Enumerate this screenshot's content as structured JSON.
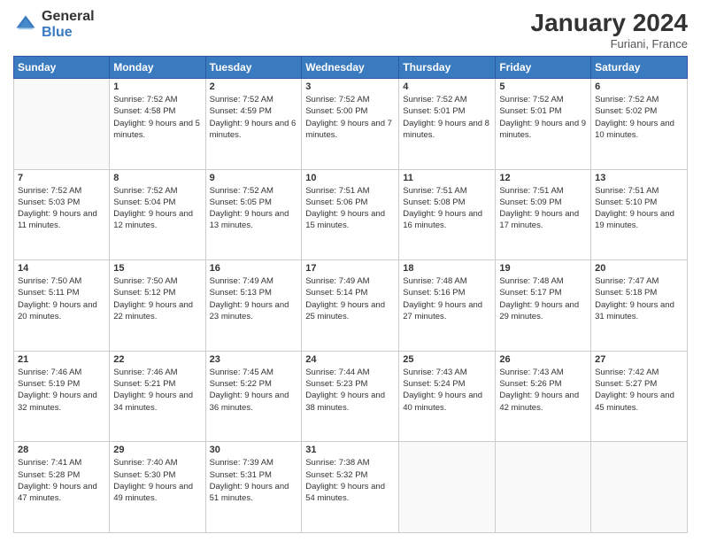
{
  "header": {
    "logo_general": "General",
    "logo_blue": "Blue",
    "month_title": "January 2024",
    "location": "Furiani, France"
  },
  "weekdays": [
    "Sunday",
    "Monday",
    "Tuesday",
    "Wednesday",
    "Thursday",
    "Friday",
    "Saturday"
  ],
  "weeks": [
    [
      {
        "day": "",
        "empty": true
      },
      {
        "day": "1",
        "sunrise": "7:52 AM",
        "sunset": "4:58 PM",
        "daylight": "9 hours and 5 minutes."
      },
      {
        "day": "2",
        "sunrise": "7:52 AM",
        "sunset": "4:59 PM",
        "daylight": "9 hours and 6 minutes."
      },
      {
        "day": "3",
        "sunrise": "7:52 AM",
        "sunset": "5:00 PM",
        "daylight": "9 hours and 7 minutes."
      },
      {
        "day": "4",
        "sunrise": "7:52 AM",
        "sunset": "5:01 PM",
        "daylight": "9 hours and 8 minutes."
      },
      {
        "day": "5",
        "sunrise": "7:52 AM",
        "sunset": "5:01 PM",
        "daylight": "9 hours and 9 minutes."
      },
      {
        "day": "6",
        "sunrise": "7:52 AM",
        "sunset": "5:02 PM",
        "daylight": "9 hours and 10 minutes."
      }
    ],
    [
      {
        "day": "7",
        "sunrise": "7:52 AM",
        "sunset": "5:03 PM",
        "daylight": "9 hours and 11 minutes."
      },
      {
        "day": "8",
        "sunrise": "7:52 AM",
        "sunset": "5:04 PM",
        "daylight": "9 hours and 12 minutes."
      },
      {
        "day": "9",
        "sunrise": "7:52 AM",
        "sunset": "5:05 PM",
        "daylight": "9 hours and 13 minutes."
      },
      {
        "day": "10",
        "sunrise": "7:51 AM",
        "sunset": "5:06 PM",
        "daylight": "9 hours and 15 minutes."
      },
      {
        "day": "11",
        "sunrise": "7:51 AM",
        "sunset": "5:08 PM",
        "daylight": "9 hours and 16 minutes."
      },
      {
        "day": "12",
        "sunrise": "7:51 AM",
        "sunset": "5:09 PM",
        "daylight": "9 hours and 17 minutes."
      },
      {
        "day": "13",
        "sunrise": "7:51 AM",
        "sunset": "5:10 PM",
        "daylight": "9 hours and 19 minutes."
      }
    ],
    [
      {
        "day": "14",
        "sunrise": "7:50 AM",
        "sunset": "5:11 PM",
        "daylight": "9 hours and 20 minutes."
      },
      {
        "day": "15",
        "sunrise": "7:50 AM",
        "sunset": "5:12 PM",
        "daylight": "9 hours and 22 minutes."
      },
      {
        "day": "16",
        "sunrise": "7:49 AM",
        "sunset": "5:13 PM",
        "daylight": "9 hours and 23 minutes."
      },
      {
        "day": "17",
        "sunrise": "7:49 AM",
        "sunset": "5:14 PM",
        "daylight": "9 hours and 25 minutes."
      },
      {
        "day": "18",
        "sunrise": "7:48 AM",
        "sunset": "5:16 PM",
        "daylight": "9 hours and 27 minutes."
      },
      {
        "day": "19",
        "sunrise": "7:48 AM",
        "sunset": "5:17 PM",
        "daylight": "9 hours and 29 minutes."
      },
      {
        "day": "20",
        "sunrise": "7:47 AM",
        "sunset": "5:18 PM",
        "daylight": "9 hours and 31 minutes."
      }
    ],
    [
      {
        "day": "21",
        "sunrise": "7:46 AM",
        "sunset": "5:19 PM",
        "daylight": "9 hours and 32 minutes."
      },
      {
        "day": "22",
        "sunrise": "7:46 AM",
        "sunset": "5:21 PM",
        "daylight": "9 hours and 34 minutes."
      },
      {
        "day": "23",
        "sunrise": "7:45 AM",
        "sunset": "5:22 PM",
        "daylight": "9 hours and 36 minutes."
      },
      {
        "day": "24",
        "sunrise": "7:44 AM",
        "sunset": "5:23 PM",
        "daylight": "9 hours and 38 minutes."
      },
      {
        "day": "25",
        "sunrise": "7:43 AM",
        "sunset": "5:24 PM",
        "daylight": "9 hours and 40 minutes."
      },
      {
        "day": "26",
        "sunrise": "7:43 AM",
        "sunset": "5:26 PM",
        "daylight": "9 hours and 42 minutes."
      },
      {
        "day": "27",
        "sunrise": "7:42 AM",
        "sunset": "5:27 PM",
        "daylight": "9 hours and 45 minutes."
      }
    ],
    [
      {
        "day": "28",
        "sunrise": "7:41 AM",
        "sunset": "5:28 PM",
        "daylight": "9 hours and 47 minutes."
      },
      {
        "day": "29",
        "sunrise": "7:40 AM",
        "sunset": "5:30 PM",
        "daylight": "9 hours and 49 minutes."
      },
      {
        "day": "30",
        "sunrise": "7:39 AM",
        "sunset": "5:31 PM",
        "daylight": "9 hours and 51 minutes."
      },
      {
        "day": "31",
        "sunrise": "7:38 AM",
        "sunset": "5:32 PM",
        "daylight": "9 hours and 54 minutes."
      },
      {
        "day": "",
        "empty": true
      },
      {
        "day": "",
        "empty": true
      },
      {
        "day": "",
        "empty": true
      }
    ]
  ]
}
